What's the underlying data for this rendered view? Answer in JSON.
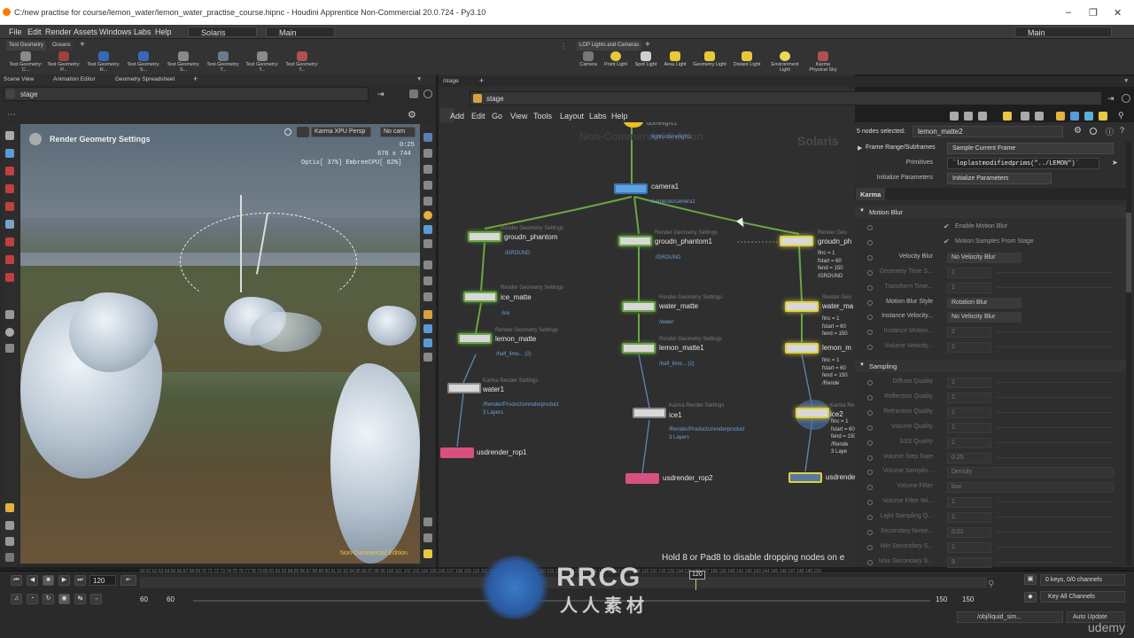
{
  "window": {
    "title": "C:/new practise for course/lemon_water/lemon_water_practise_course.hipnc - Houdini Apprentice Non-Commercial 20.0.724 - Py3.10"
  },
  "menu": [
    "File",
    "Edit",
    "Render",
    "Assets",
    "Windows",
    "Labs",
    "Help"
  ],
  "desktop": {
    "left": "Solaris",
    "right": "Main",
    "far_right": "Main"
  },
  "shelf_left": {
    "tabs": [
      "Test Geometry",
      "Oceans"
    ],
    "tools": [
      "Test Geometry: C...",
      "Test Geometry: P...",
      "Test Geometry: R...",
      "Test Geometry: S...",
      "Test Geometry: S...",
      "Test Geometry: T...",
      "Test Geometry: T...",
      "Test Geometry: T..."
    ]
  },
  "shelf_right": {
    "tabs": [
      "LOP Lights and Cameras"
    ],
    "tools": [
      "Camera",
      "Point Light",
      "Spot Light",
      "Area Light",
      "Geometry Light",
      "Distant Light",
      "Environment Light",
      "Karma Physical Sky"
    ]
  },
  "left_pane": {
    "tabs": [
      "Scene View",
      "Animation Editor",
      "Geometry Spreadsheet"
    ],
    "path": "stage",
    "overlay_title": "Render Geometry Settings",
    "renderer": "Karma XPU",
    "view": "Persp",
    "camera": "No cam",
    "stats": [
      "0:25",
      "676 x 744",
      "Optix[ 37%] EmbreeCPU[ 62%]"
    ],
    "footer": "Non-Commercial Edition"
  },
  "network": {
    "tab": "/stage",
    "path": "stage",
    "menu": [
      "Add",
      "Edit",
      "Go",
      "View",
      "Tools",
      "Layout",
      "Labs",
      "Help"
    ],
    "watermark_left": "Non-Commercial Edition",
    "watermark_right": "Solaris",
    "hint": "Hold 8 or Pad8 to disable dropping nodes on e",
    "top_path": "/lights/domelight1",
    "nodes": [
      {
        "name": "camera1",
        "sub": "",
        "path": "/cameras/camera1"
      },
      {
        "name": "groudn_phantom",
        "sub": "Render Geometry Settings",
        "path": "/GROUND"
      },
      {
        "name": "groudn_phantom1",
        "sub": "Render Geometry Settings",
        "path": "/GROUND"
      },
      {
        "name": "groudn_ph",
        "sub": "Render Geo",
        "path": "finc = 1\nfstart = 60\nfend = 150\n/GROUND"
      },
      {
        "name": "ice_matte",
        "sub": "Render Geometry Settings",
        "path": "/ice"
      },
      {
        "name": "water_matte",
        "sub": "Render Geometry Settings",
        "path": "/water"
      },
      {
        "name": "water_ma",
        "sub": "Render Geo",
        "path": "finc = 1\nfstart = 60\nfend = 150"
      },
      {
        "name": "lemon_matte",
        "sub": "Render Geometry Settings",
        "path": "/half_lime... (2)"
      },
      {
        "name": "lemon_matte1",
        "sub": "Render Geometry Settings",
        "path": "/half_lime... (2)"
      },
      {
        "name": "lemon_m",
        "sub": "Render Geo",
        "path": "finc = 1\nfstart = 60\nfend = 150\n/Rende"
      },
      {
        "name": "water1",
        "sub": "Karma Render Settings",
        "path": "/Render/Products/renderproduct\n3 Layers"
      },
      {
        "name": "ice1",
        "sub": "Karma Render Settings",
        "path": "/Render/Products/renderproduct\n3 Layers"
      },
      {
        "name": "ice2",
        "sub": "Karma Re",
        "path": "finc = 1\nfstart = 60\nfend = 150\n/Rende\n3 Laye"
      },
      {
        "name": "usdrender_rop1",
        "sub": "",
        "path": ""
      },
      {
        "name": "usdrender_rop2",
        "sub": "",
        "path": ""
      },
      {
        "name": "usdrende",
        "sub": "",
        "path": ""
      }
    ]
  },
  "params": {
    "selected": "5 nodes selected:",
    "node_name": "lemon_matte2",
    "frame_label": "Frame Range/Subframes",
    "frame_value": "Sample Current Frame",
    "prims_label": "Primitives",
    "prims_value": "`loplastmodifiedprims(\"../LEMON\")`",
    "init_label": "Initialize Parameters",
    "init_value": "Initialize Parameters",
    "tab": "Karma",
    "motion_blur": {
      "title": "Motion Blur",
      "rows": [
        {
          "label": "",
          "value": "Enable Motion Blur"
        },
        {
          "label": "",
          "value": "Motion Samples From Stage"
        },
        {
          "label": "Velocity Blur",
          "value": "No Velocity Blur"
        },
        {
          "label": "Geometry Time S...",
          "value": "1"
        },
        {
          "label": "Transform Time...",
          "value": "1"
        },
        {
          "label": "Motion Blur Style",
          "value": "Rotation Blur"
        },
        {
          "label": "Instance Velocity...",
          "value": "No Velocity Blur"
        },
        {
          "label": "Instance Motion...",
          "value": "2"
        },
        {
          "label": "Volume Velocity...",
          "value": "1"
        }
      ]
    },
    "sampling": {
      "title": "Sampling",
      "rows": [
        {
          "label": "Diffuse Quality",
          "value": "1"
        },
        {
          "label": "Reflection Quality",
          "value": "1"
        },
        {
          "label": "Refraction Quality",
          "value": "1"
        },
        {
          "label": "Volume Quality",
          "value": "1"
        },
        {
          "label": "SSS Quality",
          "value": "1"
        },
        {
          "label": "Volume Step Rate",
          "value": "0.25"
        },
        {
          "label": "Volume Samplin...",
          "value": "Density"
        },
        {
          "label": "Volume Filter",
          "value": "box"
        },
        {
          "label": "Volume Filter Wi...",
          "value": "1"
        },
        {
          "label": "Light Sampling Q...",
          "value": "1"
        },
        {
          "label": "Secondary Noise...",
          "value": "0.01"
        },
        {
          "label": "Min Secondary S...",
          "value": "1"
        },
        {
          "label": "Max Secondary S...",
          "value": "9"
        }
      ]
    }
  },
  "timeline": {
    "frame": "120",
    "start": "60",
    "start2": "60",
    "end": "150",
    "end2": "150",
    "cursor": "120",
    "keys": "0 keys, 0/0 channels",
    "key_all": "Key All Channels",
    "obj_path": "/obj/liquid_sim...",
    "auto_update": "Auto Update"
  },
  "branding": {
    "rrcg": "RRCG",
    "rrcg_sub": "人人素材",
    "udemy": "udemy"
  }
}
